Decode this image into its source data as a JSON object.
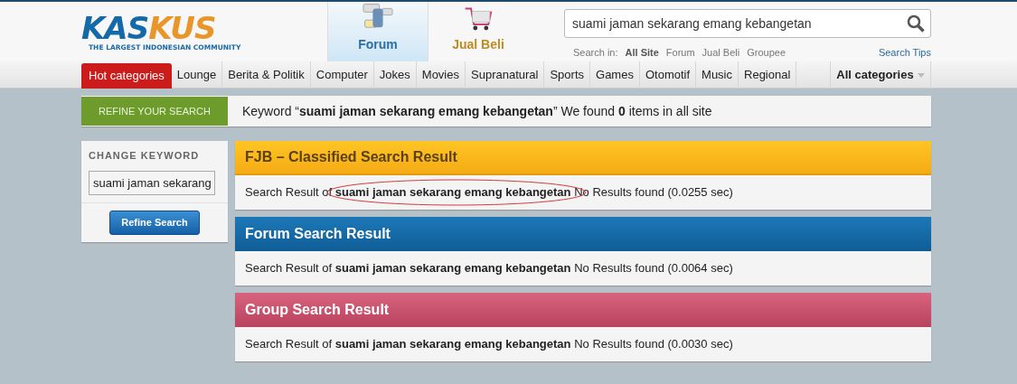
{
  "logo": {
    "part_1": "KAS",
    "part_2": "KUS",
    "tagline": "THE LARGEST INDONESIAN COMMUNITY"
  },
  "sections": [
    {
      "label": "Forum",
      "kind": "forum",
      "selected": true
    },
    {
      "label": "Jual Beli",
      "kind": "shop",
      "selected": false
    }
  ],
  "search": {
    "value": "suami jaman sekarang emang kebangetan",
    "scope_label": "Search in:",
    "scopes": [
      {
        "label": "All Site",
        "selected": true
      },
      {
        "label": "Forum",
        "selected": false
      },
      {
        "label": "Jual Beli",
        "selected": false
      },
      {
        "label": "Groupee",
        "selected": false
      }
    ],
    "tips": "Search Tips"
  },
  "nav": {
    "hot": "Hot categories",
    "items": [
      "Lounge",
      "Berita & Politik",
      "Computer",
      "Jokes",
      "Movies",
      "Supranatural",
      "Sports",
      "Games",
      "Otomotif",
      "Music",
      "Regional"
    ],
    "all": "All categories"
  },
  "refine": {
    "tab": "REFINE YOUR SEARCH",
    "summary": "Keyword “**suami jaman sekarang emang kebangetan**” We found **0** items in all site"
  },
  "sidebar": {
    "title": "CHANGE KEYWORD",
    "value": "suami jaman sekarang",
    "button": "Refine Search"
  },
  "results": [
    {
      "title": "FJB – Classified Search Result",
      "kind": "fjb",
      "prefix": "Search Result of",
      "keyword": "suami jaman sekarang emang kebangetan",
      "suffix": "No Results found (0.0255 sec)",
      "annotated": true
    },
    {
      "title": "Forum Search Result",
      "kind": "forum",
      "prefix": "Search Result of",
      "keyword": "suami jaman sekarang emang kebangetan",
      "suffix": "No Results found (0.0064 sec)",
      "annotated": false
    },
    {
      "title": "Group Search Result",
      "kind": "group",
      "prefix": "Search Result of",
      "keyword": "suami jaman sekarang emang kebangetan",
      "suffix": "No Results found (0.0030 sec)",
      "annotated": false
    }
  ]
}
